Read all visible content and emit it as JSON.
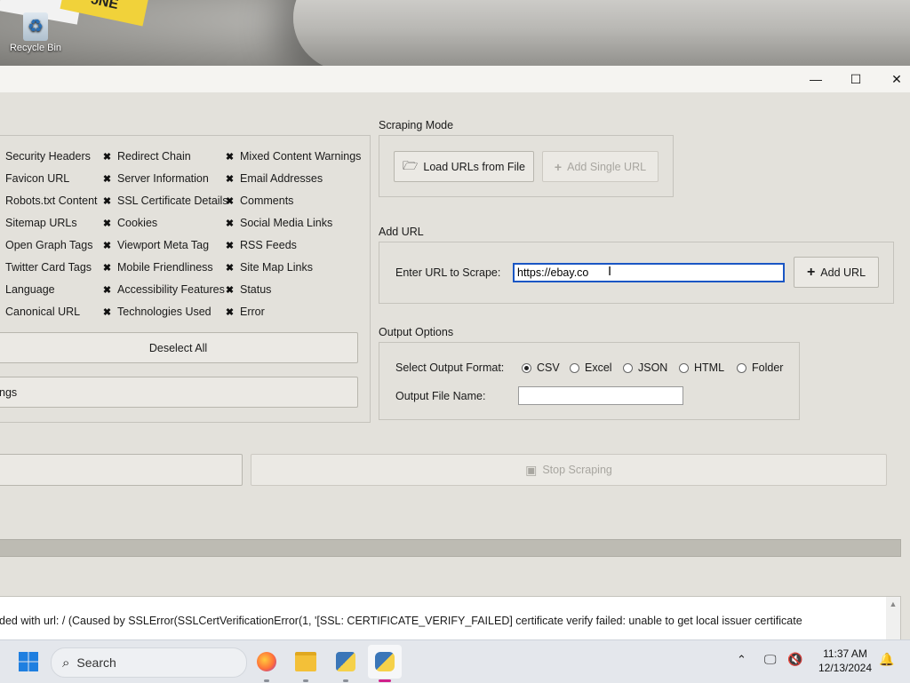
{
  "desktop": {
    "recycle_bin_label": "Recycle Bin",
    "background_text": "ɔNE"
  },
  "window": {
    "controls": {
      "minimize": "—",
      "maximize": "☐",
      "close": "✕"
    }
  },
  "fields_group": {
    "columns": [
      [
        "Security Headers",
        "Favicon URL",
        "Robots.txt Content",
        "Sitemap URLs",
        "Open Graph Tags",
        "Twitter Card Tags",
        "Language",
        "Canonical URL"
      ],
      [
        "Redirect Chain",
        "Server Information",
        "SSL Certificate Details",
        "Cookies",
        "Viewport Meta Tag",
        "Mobile Friendliness",
        "Accessibility Features",
        "Technologies Used"
      ],
      [
        "Mixed Content Warnings",
        "Email Addresses",
        "Comments",
        "Social Media Links",
        "RSS Feeds",
        "Site Map Links",
        "Status",
        "Error"
      ]
    ],
    "col1_checkboxes_visible": false,
    "col2_checked": true,
    "col3_checked": true,
    "deselect_all_label": "Deselect All",
    "partial_button_label": "ngs"
  },
  "scraping_mode": {
    "title": "Scraping Mode",
    "load_button": "Load URLs from File",
    "load_icon": "folder-open-icon",
    "add_single_button": "Add Single URL",
    "add_single_icon": "plus-icon",
    "add_single_disabled": true
  },
  "add_url": {
    "title": "Add URL",
    "label": "Enter URL to Scrape:",
    "value": "https://ebay.co",
    "button": "Add URL",
    "button_icon": "plus-icon"
  },
  "output_options": {
    "title": "Output Options",
    "format_label": "Select Output Format:",
    "formats": [
      "CSV",
      "Excel",
      "JSON",
      "HTML",
      "Folder"
    ],
    "selected_format": "CSV",
    "file_name_label": "Output File Name:",
    "file_name_value": ""
  },
  "actions": {
    "stop_button": "Stop Scraping",
    "stop_icon": "stop-icon",
    "stop_disabled": true
  },
  "log": {
    "line": "ded with url: / (Caused by SSLError(SSLCertVerificationError(1, '[SSL: CERTIFICATE_VERIFY_FAILED] certificate verify failed: unable to get local issuer certificate"
  },
  "taskbar": {
    "search_placeholder": "Search",
    "time": "11:37 AM",
    "date": "12/13/2024",
    "apps": [
      "firefox-icon",
      "file-explorer-icon",
      "python-idle-icon",
      "python-app-icon"
    ],
    "tray_icons": [
      "chevron-up-icon",
      "network-icon",
      "volume-muted-icon",
      "bell-icon"
    ]
  },
  "colors": {
    "window_bg": "#e3e1db",
    "accent_focus": "#1a56c4",
    "taskbar_bg": "#e4e7ec",
    "progress_bar": "#bdbbb3"
  }
}
